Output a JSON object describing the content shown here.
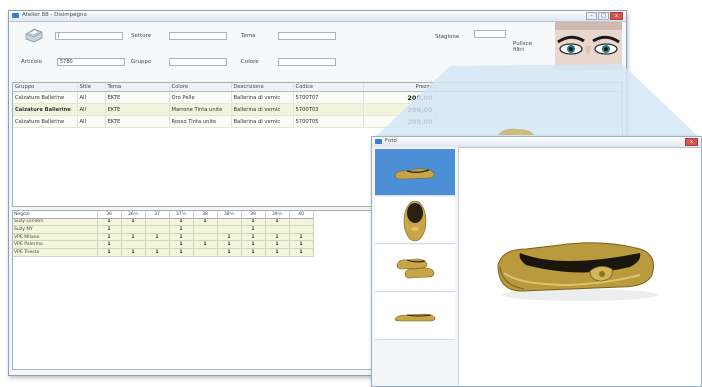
{
  "colors": {
    "accent": "#4d8fd6",
    "row_highlight": "#f1f4dc",
    "close_button": "#d9534f"
  },
  "main_window": {
    "title": "Atelier 88 - Disimpegno",
    "controls": [
      "minimize",
      "maximize",
      "close"
    ],
    "search": {
      "icon": "printer-icon",
      "field1_value": "|",
      "settore_label": "Settore",
      "tema_label": "Tema",
      "stagione_label": "Stagione",
      "articolo_label": "Articolo",
      "articolo_value": "5780",
      "gruppo_label": "Gruppo",
      "colore_label": "Colore",
      "pulisci_label": "Pulisce filtri"
    },
    "articles": {
      "columns": [
        "Gruppo",
        "Stile",
        "Tema",
        "Colore",
        "Descrizione",
        "Codice",
        "Prezzo"
      ],
      "rows": [
        {
          "gruppo": "Calzature Ballerine",
          "stile": "All",
          "tema": "EKTE",
          "colore": "Oro Pelle",
          "descrizione": "Ballerina di vernic",
          "codice": "5700T07",
          "prezzo": "200,00"
        },
        {
          "gruppo": "Calzature Ballerine",
          "stile": "All",
          "tema": "EKTE",
          "colore": "Marrone Tinta unite",
          "descrizione": "Ballerina di vernic",
          "codice": "5700T03",
          "prezzo": "200,00"
        },
        {
          "gruppo": "Calzature Ballerine",
          "stile": "All",
          "tema": "EKTE",
          "colore": "Rosso Tinta unite",
          "descrizione": "Ballerina di vernic",
          "codice": "5700T05",
          "prezzo": "200,00"
        }
      ]
    },
    "sizes": {
      "header": "Negozi",
      "columns": [
        "36",
        "36½",
        "37",
        "37½",
        "38",
        "38½",
        "39",
        "39½",
        "40"
      ],
      "rows": [
        {
          "store": "Suzy London",
          "cells": [
            "1",
            "1",
            "",
            "1",
            "1",
            "",
            "1",
            "1",
            ""
          ]
        },
        {
          "store": "Suzy NY",
          "cells": [
            "1",
            "",
            "",
            "1",
            "",
            "",
            "1",
            "",
            ""
          ]
        },
        {
          "store": "VPE Milano",
          "cells": [
            "1",
            "1",
            "1",
            "1",
            "",
            "1",
            "1",
            "1",
            "1"
          ]
        },
        {
          "store": "VPE Palermo",
          "cells": [
            "1",
            "",
            "",
            "1",
            "1",
            "1",
            "1",
            "1",
            "1"
          ]
        },
        {
          "store": "VPE Trieste",
          "cells": [
            "1",
            "1",
            "1",
            "1",
            "",
            "1",
            "1",
            "1",
            "1"
          ]
        }
      ]
    }
  },
  "photo_window": {
    "title": "Foto",
    "thumbnails": [
      "thumb-side-view",
      "thumb-top-view",
      "thumb-pair-view",
      "thumb-profile-view"
    ],
    "selected_index": 0
  }
}
